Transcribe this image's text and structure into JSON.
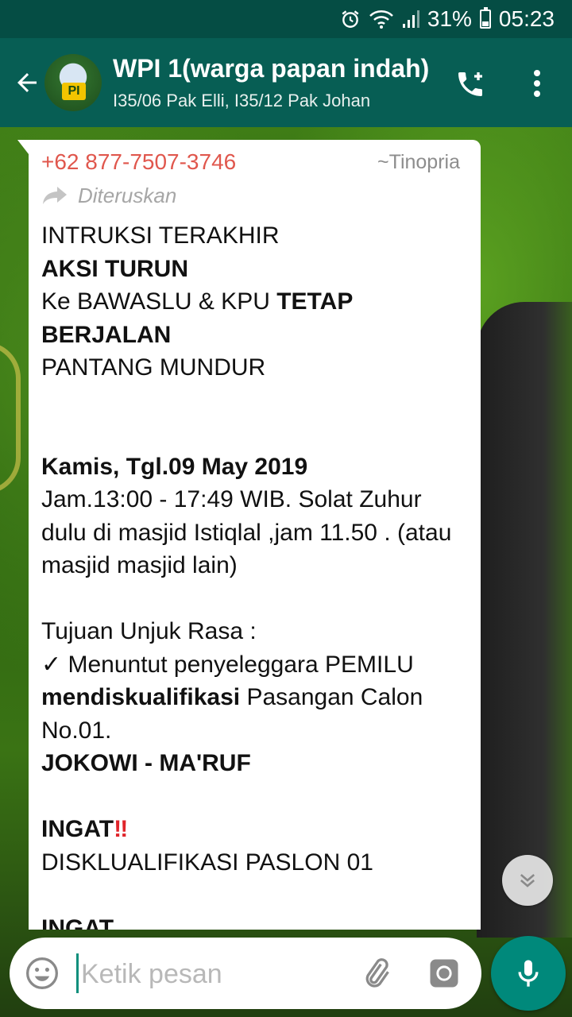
{
  "status_bar": {
    "battery": "31%",
    "time": "05:23"
  },
  "header": {
    "title": "WPI 1(warga papan indah)",
    "subtitle": "I35/06 Pak Elli, I35/12 Pak Johan",
    "avatar_badge": "PI"
  },
  "message": {
    "sender_phone": "+62 877-7507-3746",
    "sender_name": "~Tinopria",
    "forwarded_label": "Diteruskan",
    "lines": {
      "l1": "INTRUKSI TERAKHIR",
      "l2": "AKSI TURUN",
      "l3a": "Ke BAWASLU & KPU ",
      "l3b": "TETAP BERJALAN",
      "l4": "PANTANG MUNDUR",
      "l5": "Kamis, Tgl.09 May 2019",
      "l6": "Jam.13:00 - 17:49 WIB. Solat Zuhur dulu di masjid Istiqlal ,jam 11.50 . (atau masjid masjid lain)",
      "l7": "Tujuan Unjuk Rasa :",
      "l8": "✓ Menuntut penyeleggara PEMILU",
      "l9a": "mendiskualifikasi",
      "l9b": " Pasangan Calon No.01.",
      "l10": "JOKOWI - MA'RUF",
      "l11": "INGAT",
      "l11_emoji": "‼",
      "l12": "DISKLUALIFIKASI PASLON 01",
      "l13": "INGAT"
    }
  },
  "composer": {
    "placeholder": "Ketik pesan"
  },
  "colors": {
    "header": "#075e54",
    "status_bar": "#054d44",
    "sender_phone": "#e0574d",
    "accent": "#00897b"
  }
}
